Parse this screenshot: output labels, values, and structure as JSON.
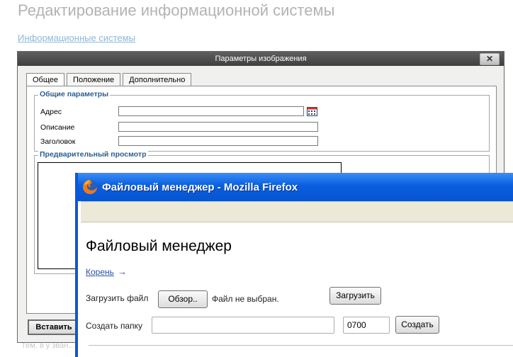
{
  "page": {
    "title": "Редактирование информационной системы",
    "link": "Информационные системы",
    "footer_partial": "Тем. в у зван..."
  },
  "dialog": {
    "title": "Параметры изображения",
    "close": "✕",
    "tabs": [
      {
        "label": "Общее",
        "active": true
      },
      {
        "label": "Положение",
        "active": false
      },
      {
        "label": "Дополнительно",
        "active": false
      }
    ],
    "general": {
      "legend": "Общие параметры",
      "address_label": "Адрес",
      "address_value": "",
      "description_label": "Описание",
      "description_value": "",
      "heading_label": "Заголовок",
      "heading_value": ""
    },
    "preview": {
      "legend": "Предварительный просмотр"
    },
    "insert_button": "Вставить"
  },
  "firefox": {
    "title": "Файловый менеджер - Mozilla Firefox",
    "heading": "Файловый менеджер",
    "root_link": "Корень",
    "root_arrow": "→",
    "upload_label": "Загрузить файл",
    "browse_button": "Обзор..",
    "no_file": "Файл не выбран.",
    "upload_button": "Загрузить",
    "create_folder_label": "Создать папку",
    "folder_name_value": "",
    "permissions_value": "0700",
    "create_button": "Создать"
  },
  "colors": {
    "accent_blue": "#0a5ee0",
    "legend_blue": "#2b5e92",
    "link_blue": "#2952a3"
  }
}
